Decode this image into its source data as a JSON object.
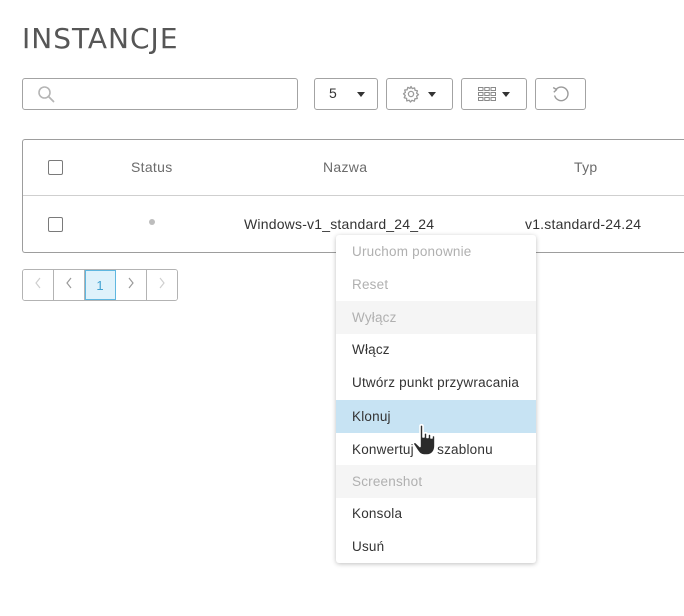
{
  "page": {
    "title": "INSTANCJE"
  },
  "toolbar": {
    "search_placeholder": "",
    "search_value": "",
    "page_size": "5",
    "icons": {
      "search": "search-icon",
      "settings": "gear-icon",
      "columns": "grid-icon",
      "refresh": "refresh-icon"
    }
  },
  "table": {
    "columns": [
      "Status",
      "Nazwa",
      "Typ"
    ],
    "rows": [
      {
        "status": "inactive",
        "name": "Windows-v1_standard_24_24",
        "type": "v1.standard-24.24"
      }
    ]
  },
  "pagination": {
    "current_page": "1"
  },
  "context_menu": {
    "items": [
      {
        "label": "Uruchom ponownie",
        "disabled": true
      },
      {
        "label": "Reset",
        "disabled": true
      },
      {
        "label": "Wyłącz",
        "disabled": true
      },
      {
        "label": "Włącz",
        "disabled": false
      },
      {
        "label": "Utwórz punkt przywracania",
        "disabled": false
      },
      {
        "label": "Klonuj",
        "disabled": false,
        "hovered": true
      },
      {
        "label": "Konwertuj do szablonu",
        "disabled": false
      },
      {
        "label": "Screenshot",
        "disabled": true
      },
      {
        "label": "Konsola",
        "disabled": false
      },
      {
        "label": "Usuń",
        "disabled": false
      }
    ]
  },
  "colors": {
    "menu_hover": "#c7e3f3",
    "active_page_bg": "#dff2fb",
    "active_page_text": "#3fa0d0",
    "status_dot": "#bdbdbd"
  }
}
